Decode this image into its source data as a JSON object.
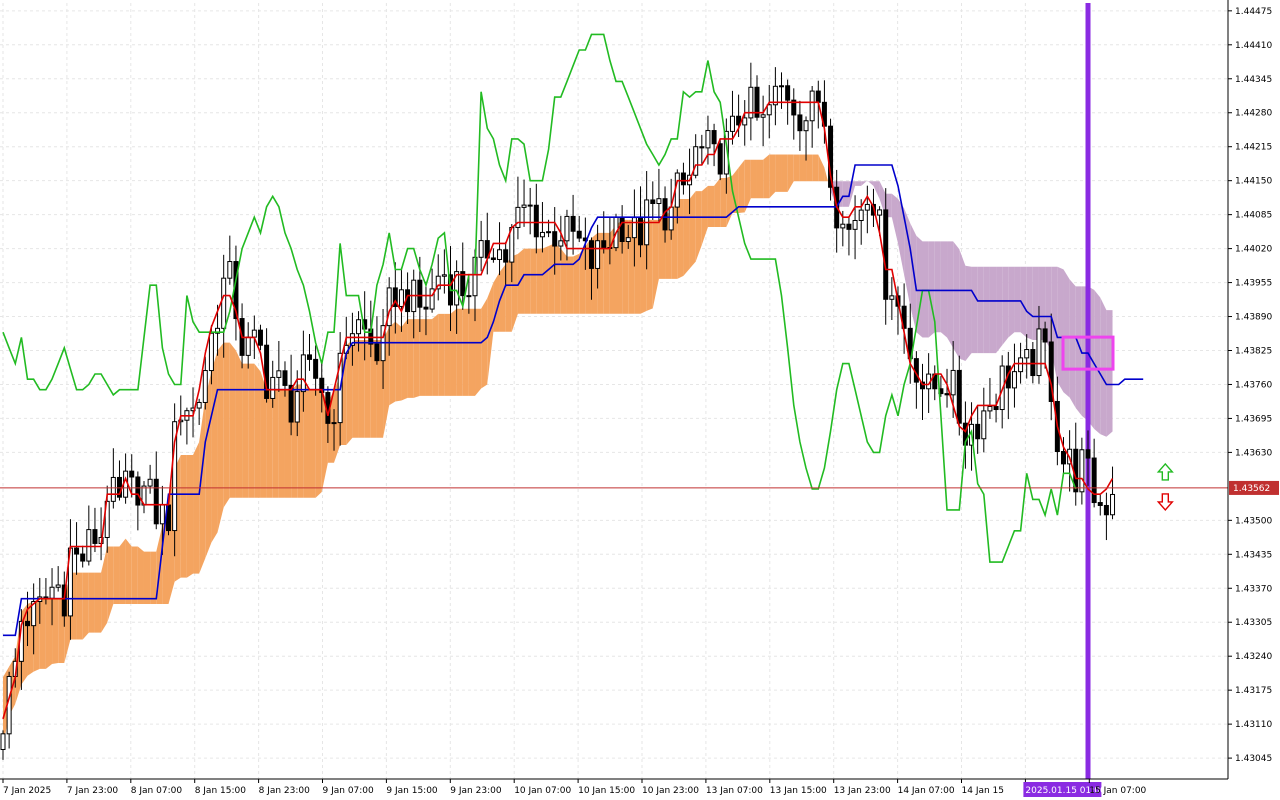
{
  "chart_data": {
    "type": "candlestick",
    "title": "",
    "y_ticks": [
      1.44475,
      1.4441,
      1.44345,
      1.4428,
      1.44215,
      1.4415,
      1.44085,
      1.4402,
      1.43955,
      1.4389,
      1.43825,
      1.4376,
      1.43695,
      1.4363,
      1.435,
      1.43435,
      1.4337,
      1.43305,
      1.4324,
      1.43175,
      1.4311,
      1.43045
    ],
    "ylim": [
      1.43005,
      1.4449
    ],
    "x_labels": [
      "7 Jan 2025",
      "7 Jan 23:00",
      "8 Jan 07:00",
      "8 Jan 15:00",
      "8 Jan 23:00",
      "9 Jan 07:00",
      "9 Jan 15:00",
      "9 Jan 23:00",
      "10 Jan 07:00",
      "10 Jan 15:00",
      "10 Jan 23:00",
      "13 Jan 07:00",
      "13 Jan 15:00",
      "13 Jan 23:00",
      "14 Jan 07:00",
      "14 Jan 15",
      "2025.01.15 01:00",
      "15 Jan 07:00"
    ],
    "current_price": 1.43562,
    "current_price_label": "1.43562",
    "cursor_index": 177,
    "grid": true,
    "colors": {
      "bull_body": "#ffffff",
      "bear_body": "#000000",
      "tenkan": "#e00000",
      "kijun": "#0000cc",
      "chikou": "#22bb22",
      "kumo_bull": "#f4a460",
      "kumo_bear": "#c8a8cc",
      "cursor_line": "#8a2be2",
      "highlight_box": "#ee44ee",
      "price_line": "#c03030",
      "arrow_up": "#22bb22",
      "arrow_down": "#e00000"
    },
    "candles": [],
    "series": {
      "tenkan": [
        1.4312,
        1.4316,
        1.432,
        1.433,
        1.4333,
        1.4334,
        1.4335,
        1.4335,
        1.4335,
        1.4335,
        1.4335,
        1.4345,
        1.4345,
        1.4345,
        1.4345,
        1.4345,
        1.4345,
        1.4355,
        1.4355,
        1.4355,
        1.4358,
        1.4355,
        1.4355,
        1.4353,
        1.4353,
        1.4353,
        1.4353,
        1.4353,
        1.4365,
        1.437,
        1.437,
        1.437,
        1.4375,
        1.4382,
        1.4387,
        1.439,
        1.4393,
        1.4393,
        1.439,
        1.4385,
        1.4385,
        1.4385,
        1.4382,
        1.4375,
        1.4375,
        1.4375,
        1.4375,
        1.4375,
        1.4377,
        1.4377,
        1.4375,
        1.4375,
        1.4375,
        1.437,
        1.4375,
        1.438,
        1.4385,
        1.4385,
        1.4385,
        1.4385,
        1.4385,
        1.4385,
        1.4385,
        1.439,
        1.4392,
        1.439,
        1.4393,
        1.4393,
        1.4393,
        1.4393,
        1.4393,
        1.4395,
        1.4395,
        1.4395,
        1.4397,
        1.4397,
        1.4397,
        1.4397,
        1.4397,
        1.44,
        1.4403,
        1.4403,
        1.4403,
        1.4406,
        1.4407,
        1.4407,
        1.4407,
        1.4407,
        1.4407,
        1.4407,
        1.4407,
        1.4405,
        1.4402,
        1.4402,
        1.4402,
        1.4402,
        1.4402,
        1.4402,
        1.4402,
        1.4402,
        1.4405,
        1.4407,
        1.4407,
        1.4407,
        1.4407,
        1.4407,
        1.4407,
        1.4407,
        1.4409,
        1.441,
        1.4415,
        1.4415,
        1.4415,
        1.4418,
        1.4418,
        1.442,
        1.442,
        1.4423,
        1.4423,
        1.4423,
        1.4425,
        1.4428,
        1.4428,
        1.4428,
        1.4428,
        1.443,
        1.443,
        1.443,
        1.443,
        1.443,
        1.443,
        1.443,
        1.443,
        1.443,
        1.4425,
        1.4416,
        1.441,
        1.4408,
        1.4408,
        1.441,
        1.441,
        1.4412,
        1.441,
        1.4405,
        1.4398,
        1.4398,
        1.4392,
        1.4386,
        1.438,
        1.4378,
        1.4376,
        1.4376,
        1.4378,
        1.4378,
        1.4376,
        1.4372,
        1.4368,
        1.4367,
        1.437,
        1.4372,
        1.4372,
        1.4372,
        1.4372,
        1.4375,
        1.4378,
        1.438,
        1.438,
        1.438,
        1.438,
        1.438,
        1.438,
        1.4376,
        1.4368,
        1.4364,
        1.4362,
        1.4358,
        1.4358,
        1.4356,
        1.4355,
        1.4355,
        1.4356,
        1.4358
      ],
      "kijun": [
        1.4328,
        1.4328,
        1.4328,
        1.4335,
        1.4335,
        1.4335,
        1.4335,
        1.4335,
        1.4335,
        1.4335,
        1.4335,
        1.4335,
        1.4335,
        1.4335,
        1.4335,
        1.4335,
        1.4335,
        1.4335,
        1.4335,
        1.4335,
        1.4335,
        1.4335,
        1.4335,
        1.4335,
        1.4335,
        1.4335,
        1.4345,
        1.4355,
        1.4355,
        1.4355,
        1.4355,
        1.4355,
        1.4355,
        1.4365,
        1.437,
        1.4375,
        1.4375,
        1.4375,
        1.4375,
        1.4375,
        1.4375,
        1.4375,
        1.4375,
        1.4375,
        1.4375,
        1.4375,
        1.4375,
        1.4375,
        1.4375,
        1.4375,
        1.4375,
        1.4375,
        1.4375,
        1.4375,
        1.4375,
        1.4375,
        1.4382,
        1.4384,
        1.4384,
        1.4384,
        1.4384,
        1.4384,
        1.4384,
        1.4384,
        1.4384,
        1.4384,
        1.4384,
        1.4384,
        1.4384,
        1.4384,
        1.4384,
        1.4384,
        1.4384,
        1.4384,
        1.4384,
        1.4384,
        1.4384,
        1.4384,
        1.4384,
        1.4385,
        1.4388,
        1.4392,
        1.4395,
        1.4395,
        1.4395,
        1.4397,
        1.4397,
        1.4397,
        1.4397,
        1.4398,
        1.4399,
        1.4399,
        1.4399,
        1.4399,
        1.44,
        1.4403,
        1.4406,
        1.4408,
        1.4408,
        1.4408,
        1.4408,
        1.4408,
        1.4408,
        1.4408,
        1.4408,
        1.4408,
        1.4408,
        1.4408,
        1.4408,
        1.4408,
        1.4408,
        1.4408,
        1.4408,
        1.4408,
        1.4408,
        1.4408,
        1.4408,
        1.4408,
        1.4408,
        1.4409,
        1.441,
        1.441,
        1.441,
        1.441,
        1.441,
        1.441,
        1.441,
        1.441,
        1.441,
        1.441,
        1.441,
        1.441,
        1.441,
        1.441,
        1.441,
        1.441,
        1.441,
        1.4412,
        1.4412,
        1.4418,
        1.4418,
        1.4418,
        1.4418,
        1.4418,
        1.4418,
        1.4418,
        1.4414,
        1.4408,
        1.4402,
        1.4394,
        1.4394,
        1.4394,
        1.4394,
        1.4394,
        1.4394,
        1.4394,
        1.4394,
        1.4394,
        1.4394,
        1.4392,
        1.4392,
        1.4392,
        1.4392,
        1.4392,
        1.4392,
        1.4392,
        1.4392,
        1.439,
        1.4389,
        1.4389,
        1.4389,
        1.4389,
        1.4385,
        1.4385,
        1.4385,
        1.4385,
        1.4382,
        1.4382,
        1.438,
        1.4378,
        1.4376,
        1.4376,
        1.4376,
        1.4377,
        1.4377,
        1.4377,
        1.4377
      ],
      "chikou": [
        1.4386,
        1.4383,
        1.438,
        1.4385,
        1.4377,
        1.4377,
        1.4375,
        1.4375,
        1.4377,
        1.438,
        1.4383,
        1.4379,
        1.4375,
        1.4375,
        1.4376,
        1.4378,
        1.4378,
        1.4376,
        1.4374,
        1.4375,
        1.4375,
        1.4375,
        1.4375,
        1.4385,
        1.4395,
        1.4395,
        1.4383,
        1.4378,
        1.4376,
        1.4376,
        1.4393,
        1.4388,
        1.4386,
        1.4386,
        1.4386,
        1.4386,
        1.4386,
        1.439,
        1.4396,
        1.4402,
        1.4405,
        1.4408,
        1.4405,
        1.441,
        1.4412,
        1.441,
        1.4405,
        1.4402,
        1.4398,
        1.4395,
        1.439,
        1.4384,
        1.438,
        1.4386,
        1.4386,
        1.4403,
        1.4393,
        1.4393,
        1.4393,
        1.4386,
        1.4386,
        1.4395,
        1.4399,
        1.4405,
        1.4398,
        1.4398,
        1.4402,
        1.4402,
        1.4398,
        1.4395,
        1.4399,
        1.4404,
        1.4405,
        1.4394,
        1.4394,
        1.4391,
        1.4397,
        1.4397,
        1.4432,
        1.4425,
        1.4423,
        1.4418,
        1.4415,
        1.4423,
        1.4423,
        1.4422,
        1.4415,
        1.4415,
        1.4415,
        1.4421,
        1.4431,
        1.4431,
        1.4434,
        1.4437,
        1.444,
        1.444,
        1.4443,
        1.4443,
        1.4443,
        1.4438,
        1.4434,
        1.4434,
        1.4431,
        1.4428,
        1.4425,
        1.4422,
        1.442,
        1.4418,
        1.442,
        1.4423,
        1.4423,
        1.4432,
        1.4431,
        1.4432,
        1.4432,
        1.4438,
        1.4432,
        1.443,
        1.4422,
        1.4413,
        1.4408,
        1.4403,
        1.44,
        1.44,
        1.44,
        1.44,
        1.44,
        1.4393,
        1.4383,
        1.4372,
        1.4365,
        1.436,
        1.4356,
        1.4356,
        1.436,
        1.4367,
        1.4375,
        1.438,
        1.438,
        1.4375,
        1.437,
        1.4365,
        1.4363,
        1.4363,
        1.437,
        1.4374,
        1.437,
        1.4376,
        1.438,
        1.4387,
        1.4394,
        1.4394,
        1.4388,
        1.437,
        1.4352,
        1.4352,
        1.4352,
        1.4365,
        1.4367,
        1.4357,
        1.4355,
        1.4342,
        1.4342,
        1.4342,
        1.4345,
        1.4348,
        1.4348,
        1.4359,
        1.4354,
        1.4354,
        1.4351,
        1.4356,
        1.4351,
        1.4359,
        1.4359,
        1.4356
      ]
    },
    "kumo": []
  }
}
